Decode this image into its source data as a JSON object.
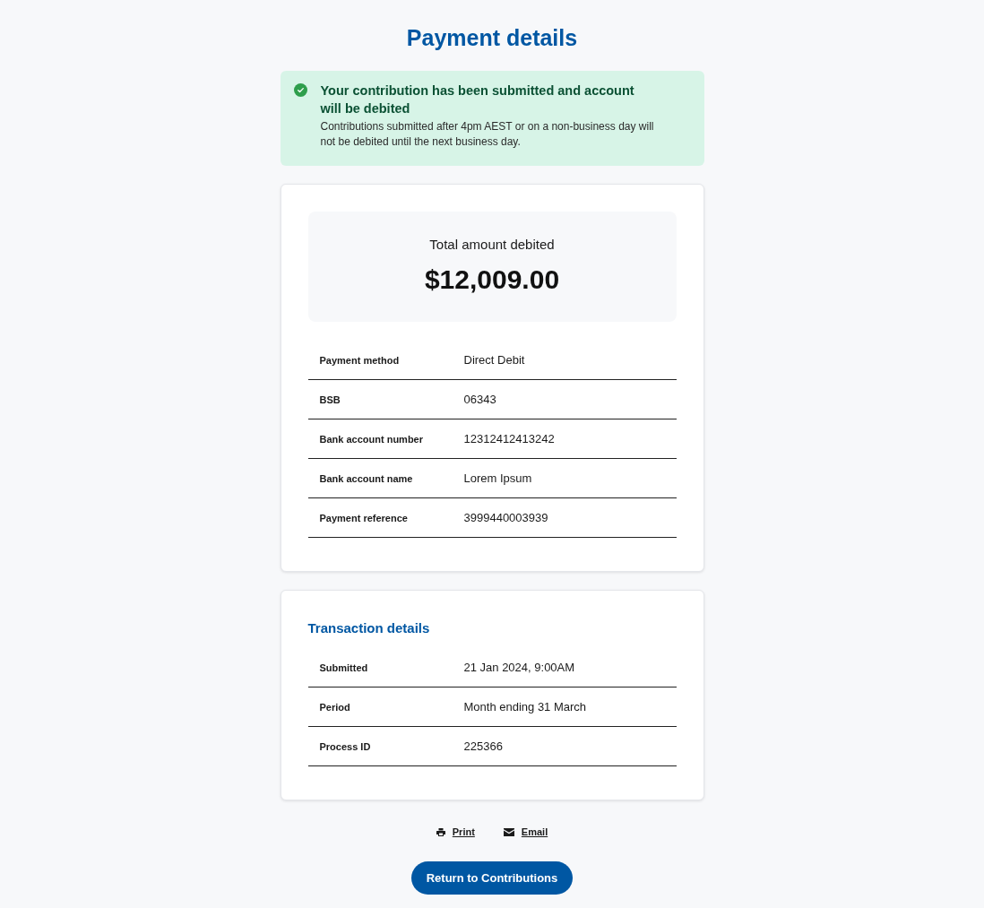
{
  "page": {
    "title": "Payment details"
  },
  "alert": {
    "kind": "success",
    "heading": "Your contribution has been submitted and account will be debited",
    "message": "Contributions submitted after 4pm AEST or on a non-business day will not be debited until the next business day."
  },
  "summary": {
    "label": "Total amount debited",
    "amount": "$12,009.00"
  },
  "payment_rows": [
    {
      "label": "Payment method",
      "value": "Direct Debit"
    },
    {
      "label": "BSB",
      "value": "06343"
    },
    {
      "label": "Bank account number",
      "value": "12312412413242"
    },
    {
      "label": "Bank account name",
      "value": "Lorem Ipsum"
    },
    {
      "label": "Payment reference",
      "value": "3999440003939"
    }
  ],
  "transaction": {
    "title": "Transaction details",
    "rows": [
      {
        "label": "Submitted",
        "value": "21 Jan 2024, 9:00AM"
      },
      {
        "label": "Period",
        "value": "Month ending 31 March"
      },
      {
        "label": "Process ID",
        "value": "225366"
      }
    ]
  },
  "actions": [
    {
      "kind": "print",
      "label": "Print"
    },
    {
      "kind": "email",
      "label": "Email"
    }
  ],
  "button": {
    "label": "Return to Contributions"
  }
}
